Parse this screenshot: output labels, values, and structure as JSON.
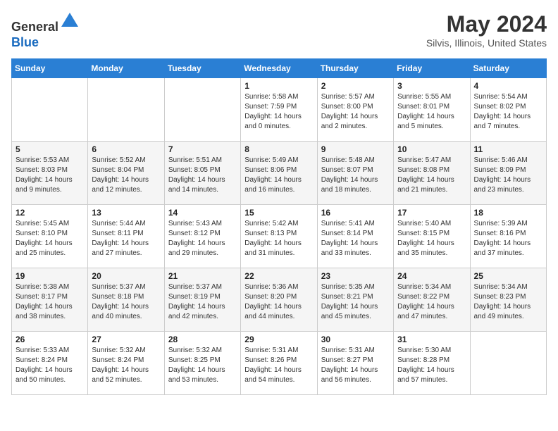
{
  "header": {
    "logo_line1": "General",
    "logo_line2": "Blue",
    "month_title": "May 2024",
    "location": "Silvis, Illinois, United States"
  },
  "days_of_week": [
    "Sunday",
    "Monday",
    "Tuesday",
    "Wednesday",
    "Thursday",
    "Friday",
    "Saturday"
  ],
  "weeks": [
    [
      {
        "day": "",
        "sunrise": "",
        "sunset": "",
        "daylight": ""
      },
      {
        "day": "",
        "sunrise": "",
        "sunset": "",
        "daylight": ""
      },
      {
        "day": "",
        "sunrise": "",
        "sunset": "",
        "daylight": ""
      },
      {
        "day": "1",
        "sunrise": "Sunrise: 5:58 AM",
        "sunset": "Sunset: 7:59 PM",
        "daylight": "Daylight: 14 hours and 0 minutes."
      },
      {
        "day": "2",
        "sunrise": "Sunrise: 5:57 AM",
        "sunset": "Sunset: 8:00 PM",
        "daylight": "Daylight: 14 hours and 2 minutes."
      },
      {
        "day": "3",
        "sunrise": "Sunrise: 5:55 AM",
        "sunset": "Sunset: 8:01 PM",
        "daylight": "Daylight: 14 hours and 5 minutes."
      },
      {
        "day": "4",
        "sunrise": "Sunrise: 5:54 AM",
        "sunset": "Sunset: 8:02 PM",
        "daylight": "Daylight: 14 hours and 7 minutes."
      }
    ],
    [
      {
        "day": "5",
        "sunrise": "Sunrise: 5:53 AM",
        "sunset": "Sunset: 8:03 PM",
        "daylight": "Daylight: 14 hours and 9 minutes."
      },
      {
        "day": "6",
        "sunrise": "Sunrise: 5:52 AM",
        "sunset": "Sunset: 8:04 PM",
        "daylight": "Daylight: 14 hours and 12 minutes."
      },
      {
        "day": "7",
        "sunrise": "Sunrise: 5:51 AM",
        "sunset": "Sunset: 8:05 PM",
        "daylight": "Daylight: 14 hours and 14 minutes."
      },
      {
        "day": "8",
        "sunrise": "Sunrise: 5:49 AM",
        "sunset": "Sunset: 8:06 PM",
        "daylight": "Daylight: 14 hours and 16 minutes."
      },
      {
        "day": "9",
        "sunrise": "Sunrise: 5:48 AM",
        "sunset": "Sunset: 8:07 PM",
        "daylight": "Daylight: 14 hours and 18 minutes."
      },
      {
        "day": "10",
        "sunrise": "Sunrise: 5:47 AM",
        "sunset": "Sunset: 8:08 PM",
        "daylight": "Daylight: 14 hours and 21 minutes."
      },
      {
        "day": "11",
        "sunrise": "Sunrise: 5:46 AM",
        "sunset": "Sunset: 8:09 PM",
        "daylight": "Daylight: 14 hours and 23 minutes."
      }
    ],
    [
      {
        "day": "12",
        "sunrise": "Sunrise: 5:45 AM",
        "sunset": "Sunset: 8:10 PM",
        "daylight": "Daylight: 14 hours and 25 minutes."
      },
      {
        "day": "13",
        "sunrise": "Sunrise: 5:44 AM",
        "sunset": "Sunset: 8:11 PM",
        "daylight": "Daylight: 14 hours and 27 minutes."
      },
      {
        "day": "14",
        "sunrise": "Sunrise: 5:43 AM",
        "sunset": "Sunset: 8:12 PM",
        "daylight": "Daylight: 14 hours and 29 minutes."
      },
      {
        "day": "15",
        "sunrise": "Sunrise: 5:42 AM",
        "sunset": "Sunset: 8:13 PM",
        "daylight": "Daylight: 14 hours and 31 minutes."
      },
      {
        "day": "16",
        "sunrise": "Sunrise: 5:41 AM",
        "sunset": "Sunset: 8:14 PM",
        "daylight": "Daylight: 14 hours and 33 minutes."
      },
      {
        "day": "17",
        "sunrise": "Sunrise: 5:40 AM",
        "sunset": "Sunset: 8:15 PM",
        "daylight": "Daylight: 14 hours and 35 minutes."
      },
      {
        "day": "18",
        "sunrise": "Sunrise: 5:39 AM",
        "sunset": "Sunset: 8:16 PM",
        "daylight": "Daylight: 14 hours and 37 minutes."
      }
    ],
    [
      {
        "day": "19",
        "sunrise": "Sunrise: 5:38 AM",
        "sunset": "Sunset: 8:17 PM",
        "daylight": "Daylight: 14 hours and 38 minutes."
      },
      {
        "day": "20",
        "sunrise": "Sunrise: 5:37 AM",
        "sunset": "Sunset: 8:18 PM",
        "daylight": "Daylight: 14 hours and 40 minutes."
      },
      {
        "day": "21",
        "sunrise": "Sunrise: 5:37 AM",
        "sunset": "Sunset: 8:19 PM",
        "daylight": "Daylight: 14 hours and 42 minutes."
      },
      {
        "day": "22",
        "sunrise": "Sunrise: 5:36 AM",
        "sunset": "Sunset: 8:20 PM",
        "daylight": "Daylight: 14 hours and 44 minutes."
      },
      {
        "day": "23",
        "sunrise": "Sunrise: 5:35 AM",
        "sunset": "Sunset: 8:21 PM",
        "daylight": "Daylight: 14 hours and 45 minutes."
      },
      {
        "day": "24",
        "sunrise": "Sunrise: 5:34 AM",
        "sunset": "Sunset: 8:22 PM",
        "daylight": "Daylight: 14 hours and 47 minutes."
      },
      {
        "day": "25",
        "sunrise": "Sunrise: 5:34 AM",
        "sunset": "Sunset: 8:23 PM",
        "daylight": "Daylight: 14 hours and 49 minutes."
      }
    ],
    [
      {
        "day": "26",
        "sunrise": "Sunrise: 5:33 AM",
        "sunset": "Sunset: 8:24 PM",
        "daylight": "Daylight: 14 hours and 50 minutes."
      },
      {
        "day": "27",
        "sunrise": "Sunrise: 5:32 AM",
        "sunset": "Sunset: 8:24 PM",
        "daylight": "Daylight: 14 hours and 52 minutes."
      },
      {
        "day": "28",
        "sunrise": "Sunrise: 5:32 AM",
        "sunset": "Sunset: 8:25 PM",
        "daylight": "Daylight: 14 hours and 53 minutes."
      },
      {
        "day": "29",
        "sunrise": "Sunrise: 5:31 AM",
        "sunset": "Sunset: 8:26 PM",
        "daylight": "Daylight: 14 hours and 54 minutes."
      },
      {
        "day": "30",
        "sunrise": "Sunrise: 5:31 AM",
        "sunset": "Sunset: 8:27 PM",
        "daylight": "Daylight: 14 hours and 56 minutes."
      },
      {
        "day": "31",
        "sunrise": "Sunrise: 5:30 AM",
        "sunset": "Sunset: 8:28 PM",
        "daylight": "Daylight: 14 hours and 57 minutes."
      },
      {
        "day": "",
        "sunrise": "",
        "sunset": "",
        "daylight": ""
      }
    ]
  ]
}
